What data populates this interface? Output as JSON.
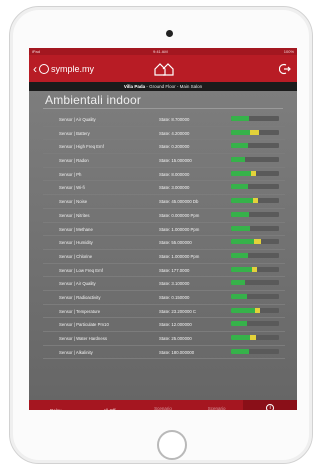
{
  "status_bar": {
    "left": "iPad",
    "center": "9:41 AM",
    "right": "100%"
  },
  "app_bar": {
    "back_label": "symple.my",
    "home_icon": "home-icon",
    "exit_icon": "exit-icon"
  },
  "breadcrumb": {
    "strong": "Villa Pada",
    "rest": " - Ground Floor - Main Salon"
  },
  "section": {
    "title": "Ambientali indoor"
  },
  "sensors": [
    {
      "name": "Sensor | Air Quality",
      "state": "State: 8.700000",
      "green": 0.38,
      "yellow": 0
    },
    {
      "name": "Sensor | Battery",
      "state": "State: 4.200000",
      "green": 0.4,
      "yellow": 0.18
    },
    {
      "name": "Sensor | High Freq Emf",
      "state": "State: 0.200000",
      "green": 0.35,
      "yellow": 0
    },
    {
      "name": "Sensor | Radon",
      "state": "State: 15.000000",
      "green": 0.3,
      "yellow": 0
    },
    {
      "name": "Sensor | Ph",
      "state": "State: 8.000000",
      "green": 0.42,
      "yellow": 0.1
    },
    {
      "name": "Sensor | Wi-fi",
      "state": "State: 3.000000",
      "green": 0.35,
      "yellow": 0
    },
    {
      "name": "Sensor | Noise",
      "state": "State: 45.000000 Db",
      "green": 0.45,
      "yellow": 0.12
    },
    {
      "name": "Sensor | Nitrites",
      "state": "State: 0.000000 Ppm",
      "green": 0.38,
      "yellow": 0
    },
    {
      "name": "Sensor | Methane",
      "state": "State: 1.000000 Ppm",
      "green": 0.4,
      "yellow": 0
    },
    {
      "name": "Sensor | Humidity",
      "state": "State: 55.000000",
      "green": 0.48,
      "yellow": 0.14
    },
    {
      "name": "Sensor | Chlorine",
      "state": "State: 1.000000 Ppm",
      "green": 0.36,
      "yellow": 0
    },
    {
      "name": "Sensor | Low Freq Emf",
      "state": "State: 177.0000",
      "green": 0.44,
      "yellow": 0.1
    },
    {
      "name": "Sensor | Air Quality",
      "state": "State: 3.100000",
      "green": 0.3,
      "yellow": 0
    },
    {
      "name": "Sensor | Radioactivity",
      "state": "State: 0.150000",
      "green": 0.33,
      "yellow": 0
    },
    {
      "name": "Sensor | Temperature",
      "state": "State: 23.200000 C",
      "green": 0.5,
      "yellow": 0.1
    },
    {
      "name": "Sensor | Particulate Pm10",
      "state": "State: 12.000000",
      "green": 0.34,
      "yellow": 0
    },
    {
      "name": "Sensor | Water Hardness",
      "state": "State: 25.000000",
      "green": 0.4,
      "yellow": 0.12
    },
    {
      "name": "Sensor | Alkalinity",
      "state": "State: 180.000000",
      "green": 0.38,
      "yellow": 0
    }
  ],
  "tabs": [
    {
      "line1": "Relax",
      "line2": "",
      "active": false,
      "dim": false
    },
    {
      "line1": "All Off",
      "line2": "",
      "active": false,
      "dim": false
    },
    {
      "line1": "Scenario",
      "line2": "not used",
      "active": false,
      "dim": true
    },
    {
      "line1": "Scenario",
      "line2": "not used",
      "active": false,
      "dim": true
    },
    {
      "line1": "i",
      "line2": "info",
      "active": true,
      "dim": false
    }
  ],
  "colors": {
    "accent": "#b81c25",
    "ok": "#36b24a",
    "warn": "#e3d23a"
  }
}
